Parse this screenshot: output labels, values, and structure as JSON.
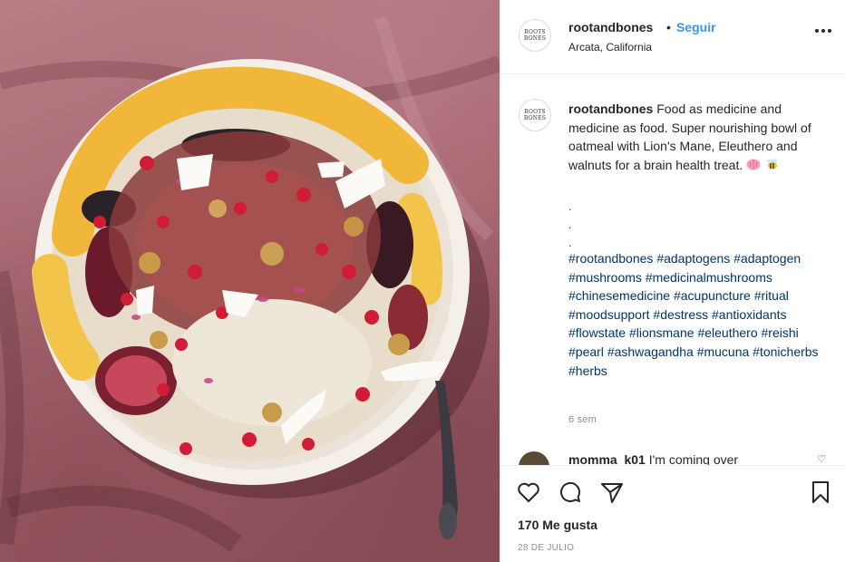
{
  "post": {
    "image_alt": "Bowl of oatmeal with pomegranate, figs, walnuts, coconut flakes and mango on a pink linen cloth"
  },
  "header": {
    "avatar_line1": "ROOTS",
    "avatar_line2": "BONES",
    "username": "rootandbones",
    "separator": "•",
    "follow_label": "Seguir",
    "location": "Arcata, California",
    "more_icon": "more-horizontal-icon"
  },
  "caption": {
    "username": "rootandbones",
    "text": "Food as medicine and medicine as food. Super nourishing bowl of oatmeal with Lion's Mane, Eleuthero and walnuts for a brain health treat.",
    "emojis": [
      "brain-emoji",
      "bee-emoji"
    ],
    "dot_lines": [
      ".",
      ".",
      "."
    ],
    "hashtags": [
      "#rootandbones",
      "#adaptogens",
      "#adaptogen",
      "#mushrooms",
      "#medicinalmushrooms",
      "#chinesemedicine",
      "#acupuncture",
      "#ritual",
      "#moodsupport",
      "#destress",
      "#antioxidants",
      "#flowstate",
      "#lionsmane",
      "#eleuthero",
      "#reishi",
      "#pearl",
      "#ashwagandha",
      "#mucuna",
      "#tonicherbs",
      "#herbs"
    ],
    "time_ago": "6 sem"
  },
  "comment_peek": {
    "username": "momma_k01",
    "text": "I'm coming over"
  },
  "actions": {
    "icons": [
      "heart-icon",
      "comment-icon",
      "share-icon",
      "bookmark-icon"
    ],
    "likes": "170 Me gusta",
    "date": "28 DE JULIO"
  },
  "colors": {
    "link_blue": "#3897f0",
    "hashtag": "#003569",
    "muted": "#8e8e8e",
    "text": "#262626",
    "border": "#efefef",
    "cloth": "#a76872"
  }
}
